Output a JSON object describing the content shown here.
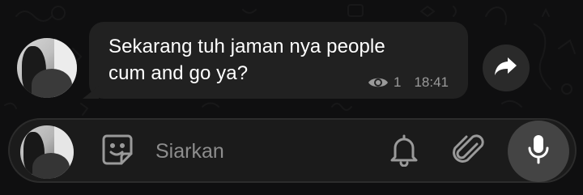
{
  "message": {
    "text": "Sekarang tuh jaman nya people\ncum and go ya?",
    "views": "1",
    "time": "18:41",
    "views_icon": "eye-icon"
  },
  "actions": {
    "forward_icon": "forward-arrow-icon"
  },
  "composer": {
    "placeholder": "Siarkan",
    "value": "",
    "sticker_icon": "sticker-icon",
    "notify_icon": "bell-icon",
    "attach_icon": "paperclip-icon",
    "mic_icon": "microphone-icon"
  },
  "colors": {
    "background": "#0f0f10",
    "bubble": "#212121",
    "text": "#ffffff",
    "meta": "#9a9a9a",
    "mic_button": "#444444"
  }
}
